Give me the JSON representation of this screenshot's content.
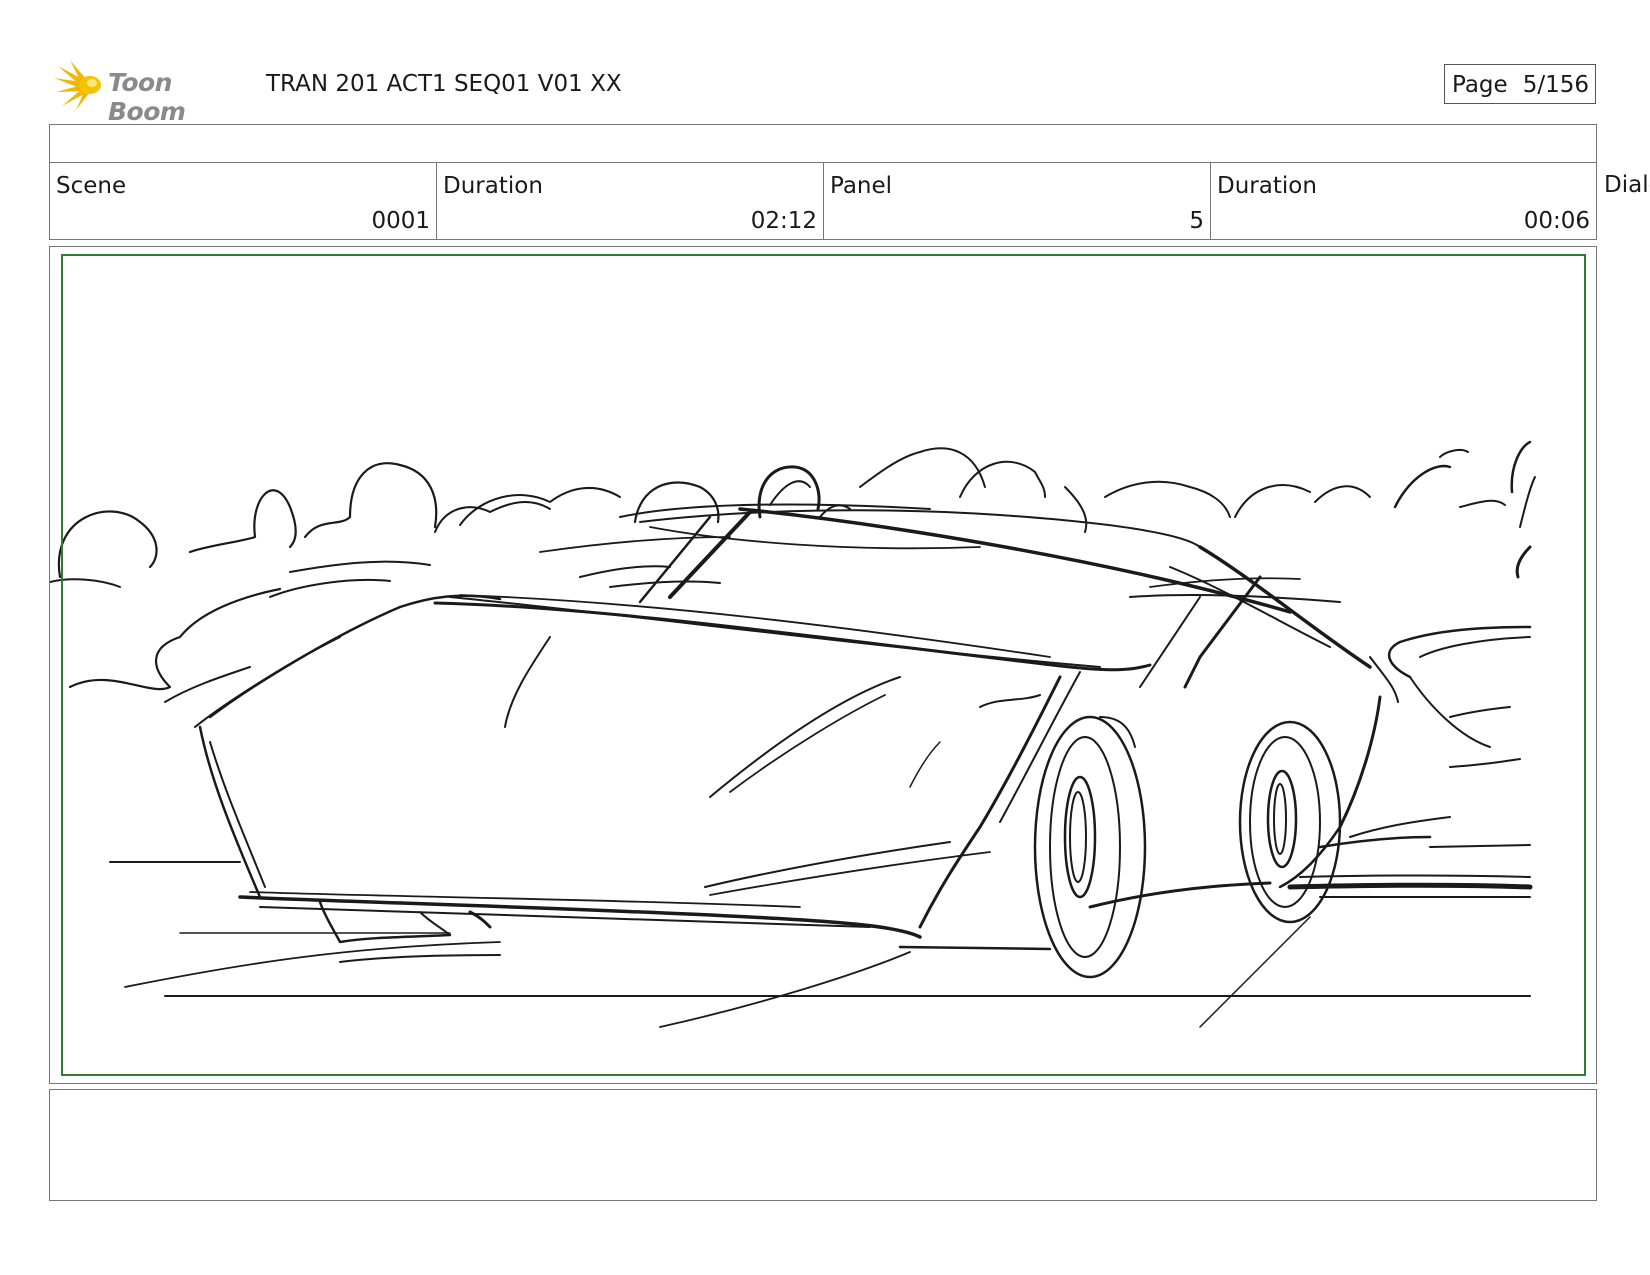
{
  "header": {
    "logo_text": "Toon Boom",
    "title": "TRAN 201 ACT1 SEQ01 V01 XX",
    "page_label": "Page",
    "page_value": "5/156"
  },
  "info": {
    "scene_label": "Scene",
    "scene_value": "0001",
    "scene_duration_label": "Duration",
    "scene_duration_value": "02:12",
    "panel_label": "Panel",
    "panel_value": "5",
    "panel_duration_label": "Duration",
    "panel_duration_value": "00:06",
    "dialog_label": "Dialo"
  },
  "panel_image": {
    "icon": "storyboard-sketch-car",
    "colors": {
      "safe_frame": "#2e7d32",
      "ink": "#1a1a1a"
    }
  },
  "action_notes": ""
}
